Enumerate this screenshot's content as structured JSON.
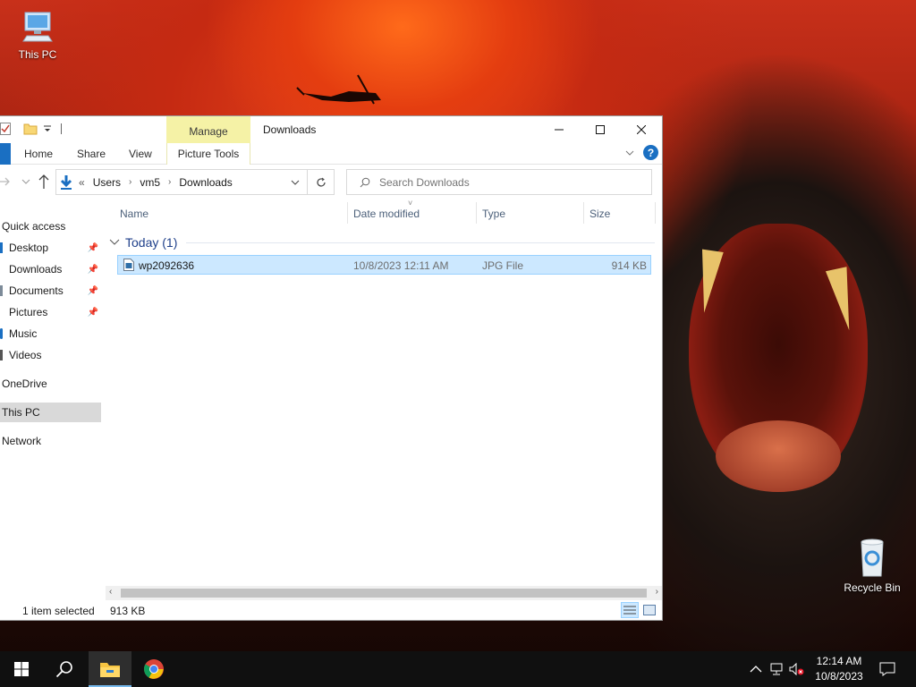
{
  "desktop": {
    "icons": [
      {
        "label": "This PC",
        "icon": "this-pc-icon"
      },
      {
        "label": "Recycle Bin",
        "icon": "recycle-bin-icon"
      }
    ]
  },
  "window": {
    "title": "Downloads",
    "contextual_tab": "Manage",
    "contextual_group": "Picture Tools",
    "ribbon_tabs": [
      "Home",
      "Share",
      "View"
    ],
    "address": {
      "overflow": "«",
      "crumbs": [
        "Users",
        "vm5",
        "Downloads"
      ]
    },
    "search": {
      "placeholder": "Search Downloads"
    },
    "nav": {
      "quick_access": "Quick access",
      "items": [
        {
          "label": "Desktop",
          "pinned": true
        },
        {
          "label": "Downloads",
          "pinned": true
        },
        {
          "label": "Documents",
          "pinned": true
        },
        {
          "label": "Pictures",
          "pinned": true
        },
        {
          "label": "Music",
          "pinned": false
        },
        {
          "label": "Videos",
          "pinned": false
        }
      ],
      "onedrive": "OneDrive",
      "this_pc": "This PC",
      "network": "Network"
    },
    "columns": [
      "Name",
      "Date modified",
      "Type",
      "Size"
    ],
    "group": {
      "title": "Today (1)"
    },
    "files": [
      {
        "name": "wp2092636",
        "date": "10/8/2023 12:11 AM",
        "type": "JPG File",
        "size": "914 KB",
        "selected": true
      }
    ],
    "status": {
      "selection": "1 item selected",
      "size": "913 KB"
    }
  },
  "taskbar": {
    "time": "12:14 AM",
    "date": "10/8/2023"
  },
  "colors": {
    "accent": "#1a6fc2",
    "selection": "#cce8ff",
    "manage_tab": "#f5f2a6",
    "taskbar": "#101010"
  }
}
